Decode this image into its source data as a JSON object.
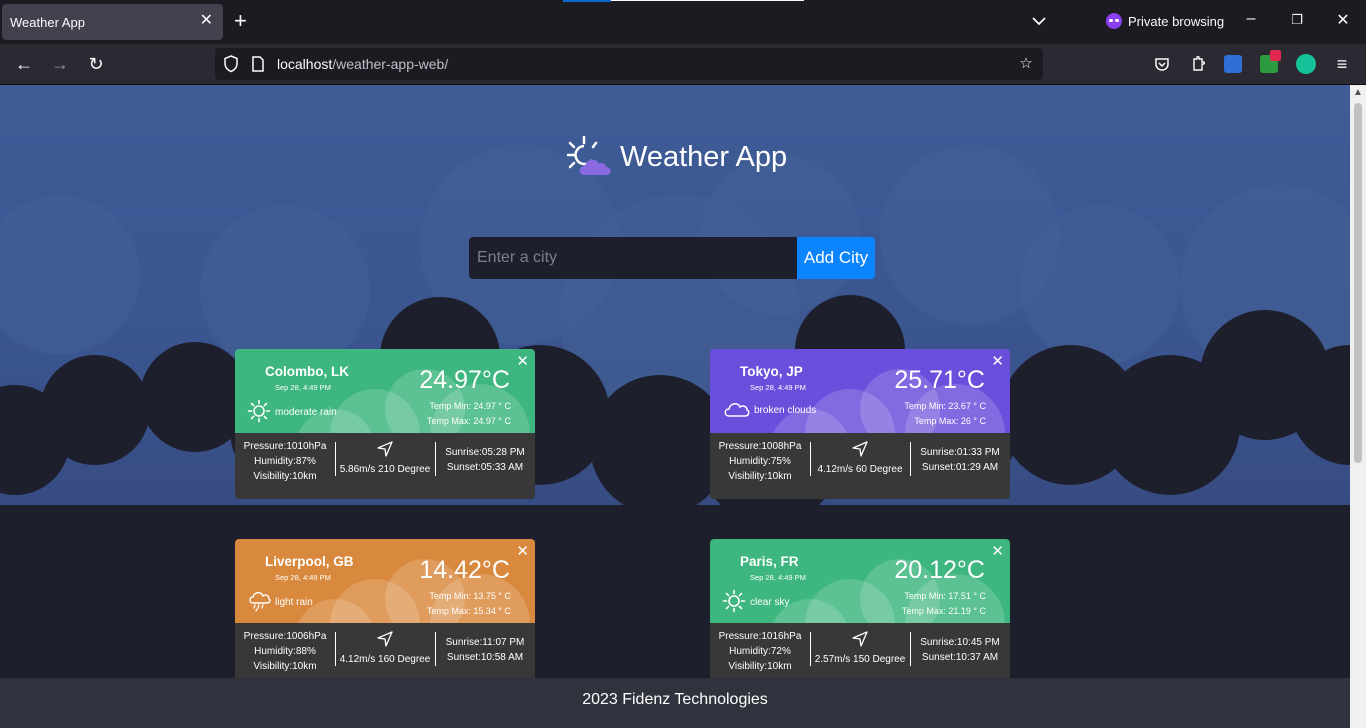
{
  "browser": {
    "tab_title": "Weather App",
    "private_label": "Private browsing",
    "url_host": "localhost",
    "url_path": "/weather-app-web/"
  },
  "app": {
    "title": "Weather App",
    "search_placeholder": "Enter a city",
    "add_button": "Add City",
    "footer": "2023 Fidenz Technologies"
  },
  "cards": [
    {
      "city": "Colombo, LK",
      "date": "Sep 28, 4:49 PM",
      "description": "moderate rain",
      "temp": "24.97°C",
      "temp_min": "Temp Min: 24.97 ° C",
      "temp_max": "Temp Max: 24.97 ° C",
      "pressure": "Pressure:1010hPa",
      "humidity": "Humidity:87%",
      "visibility": "Visibility:10km",
      "wind": "5.86m/s 210 Degree",
      "sunrise": "Sunrise:05:28 PM",
      "sunset": "Sunset:05:33 AM",
      "color": "#3db67f",
      "icon": "sun-icon"
    },
    {
      "city": "Tokyo, JP",
      "date": "Sep 28, 4:49 PM",
      "description": "broken clouds",
      "temp": "25.71°C",
      "temp_min": "Temp Min: 23.67 ° C",
      "temp_max": "Temp Max: 26 ° C",
      "pressure": "Pressure:1008hPa",
      "humidity": "Humidity:75%",
      "visibility": "Visibility:10km",
      "wind": "4.12m/s 60 Degree",
      "sunrise": "Sunrise:01:33 PM",
      "sunset": "Sunset:01:29 AM",
      "color": "#6a4fdc",
      "icon": "cloud-icon"
    },
    {
      "city": "Liverpool, GB",
      "date": "Sep 28, 4:49 PM",
      "description": "light rain",
      "temp": "14.42°C",
      "temp_min": "Temp Min: 13.75 ° C",
      "temp_max": "Temp Max: 15.34 ° C",
      "pressure": "Pressure:1006hPa",
      "humidity": "Humidity:88%",
      "visibility": "Visibility:10km",
      "wind": "4.12m/s 160 Degree",
      "sunrise": "Sunrise:11:07 PM",
      "sunset": "Sunset:10:58 AM",
      "color": "#d9893d",
      "icon": "rain-cloud-icon"
    },
    {
      "city": "Paris, FR",
      "date": "Sep 28, 4:49 PM",
      "description": "clear sky",
      "temp": "20.12°C",
      "temp_min": "Temp Min: 17.51 ° C",
      "temp_max": "Temp Max: 21.19 ° C",
      "pressure": "Pressure:1016hPa",
      "humidity": "Humidity:72%",
      "visibility": "Visibility:10km",
      "wind": "2.57m/s 150 Degree",
      "sunrise": "Sunrise:10:45 PM",
      "sunset": "Sunset:10:37 AM",
      "color": "#3db67f",
      "icon": "sun-icon"
    }
  ]
}
